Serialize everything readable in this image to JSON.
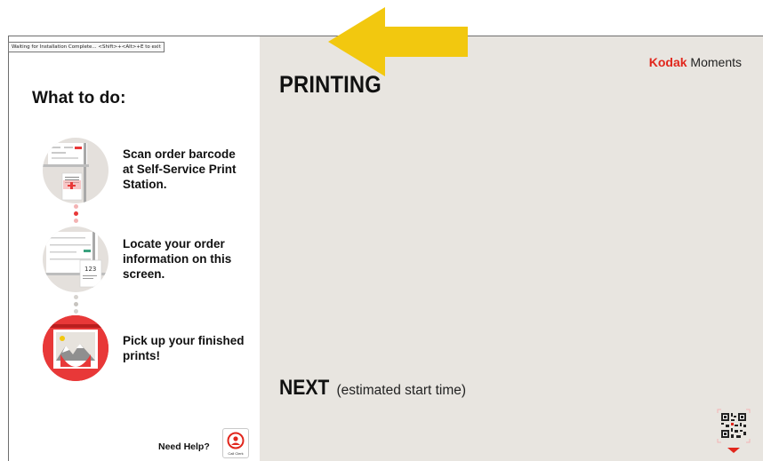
{
  "installer": {
    "status_text": "Waiting for Installation Complete... <Shift>+<Alt>+E to exit"
  },
  "instructions": {
    "title": "What to do:",
    "steps": [
      {
        "text": "Scan order barcode at Self-Service Print Station.",
        "icon": "barcode-scan-illustration-icon"
      },
      {
        "text": "Locate your order information on this screen.",
        "icon": "order-screen-illustration-icon",
        "sample_order_number": "123"
      },
      {
        "text": "Pick up your finished prints!",
        "icon": "photo-print-illustration-icon"
      }
    ]
  },
  "help": {
    "label": "Need Help?",
    "button_caption": "Call Clerk",
    "icon": "person-icon"
  },
  "brand": {
    "name_bold": "Kodak",
    "name_rest": " Moments"
  },
  "main": {
    "printing_title": "PRINTING",
    "next_title": "NEXT",
    "next_subtitle": "(estimated start time)"
  },
  "overlay": {
    "arrow_icon": "left-arrow-icon"
  },
  "colors": {
    "accent_red": "#e1261c",
    "panel_background": "#e8e5e0",
    "arrow_yellow": "#f2c80f"
  }
}
